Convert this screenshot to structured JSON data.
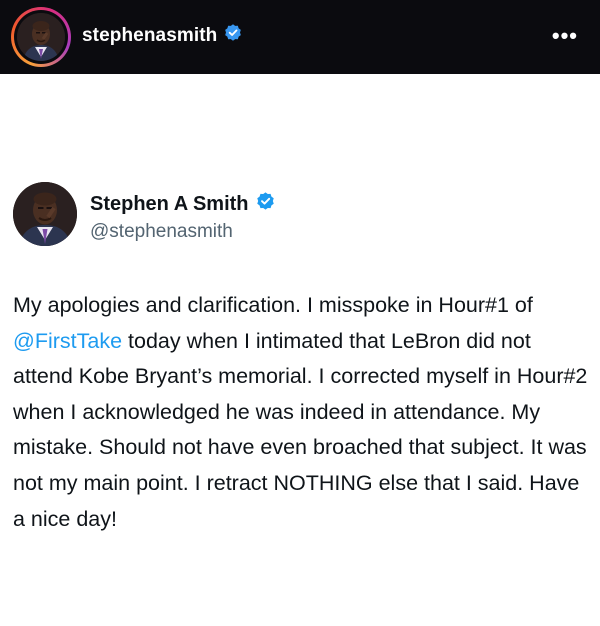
{
  "ig_header": {
    "username": "stephenasmith",
    "more_label": "•••",
    "verified_color": "#3897f0"
  },
  "tweet": {
    "display_name": "Stephen A Smith",
    "handle": "@stephenasmith",
    "verified_color": "#1d9bf0",
    "mention_color": "#1d9bf0",
    "text_before_mention": "My apologies and clarification. I misspoke in Hour#1 of ",
    "mention": "@FirstTake",
    "text_after_mention": " today when I intimated that LeBron did not attend Kobe Bryant’s memorial. I corrected myself in Hour#2 when I acknowledged he was indeed in attendance. My mistake. Should not have even broached that subject. It was not my main point. I retract NOTHING else that I said. Have a nice day!"
  }
}
